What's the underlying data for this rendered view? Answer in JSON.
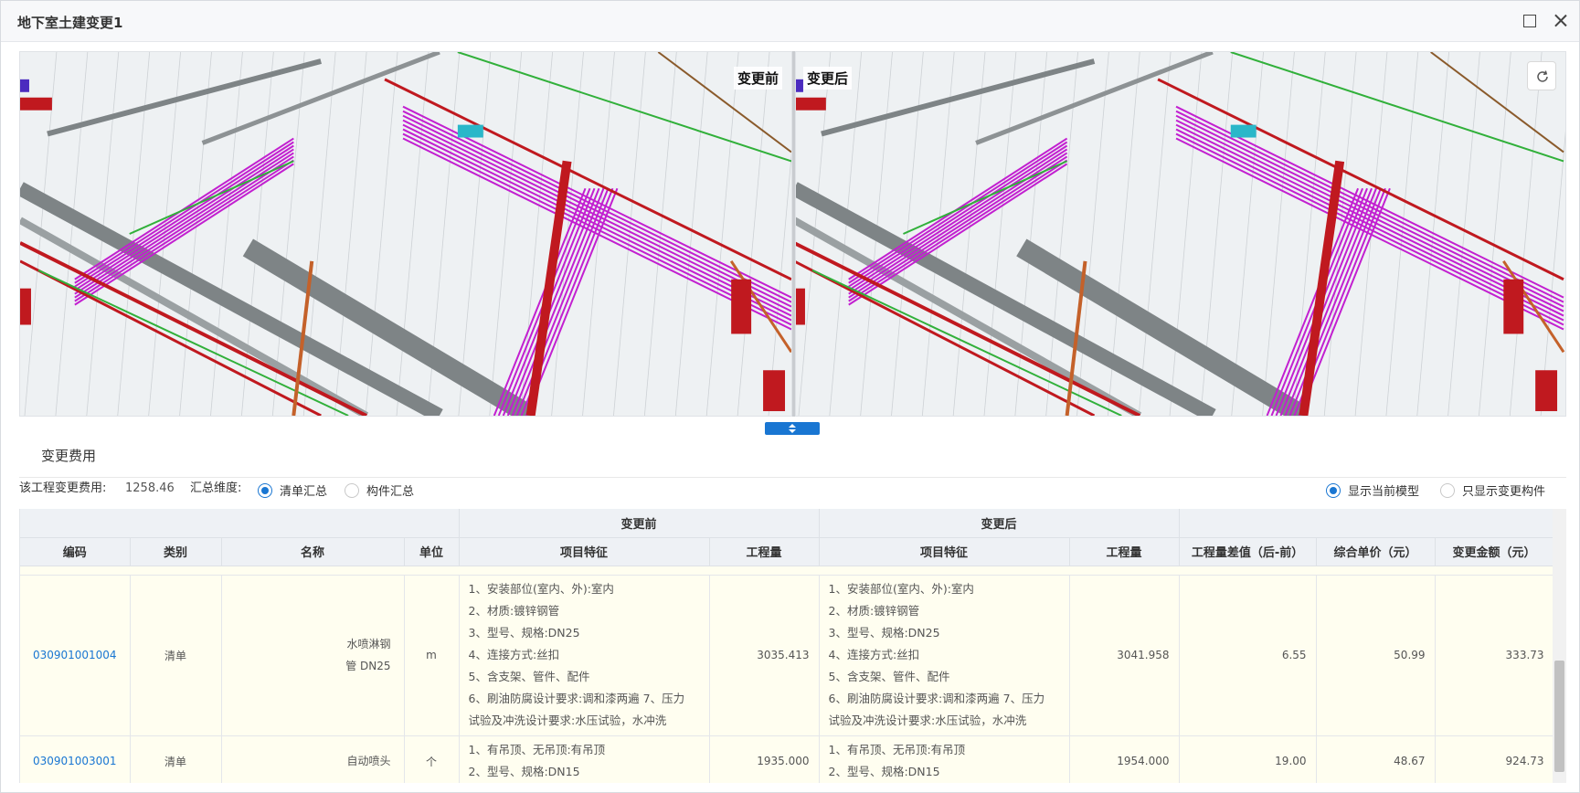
{
  "window": {
    "title": "地下室土建变更1"
  },
  "viewers": {
    "before_label": "变更前",
    "after_label": "变更后"
  },
  "section": {
    "title": "变更费用"
  },
  "filters": {
    "total_label": "该工程变更费用:",
    "total_value": "1258.46",
    "dimension_label": "汇总维度:",
    "option_list": "清单汇总",
    "option_component": "构件汇总",
    "option_list_selected": true,
    "show_current": "显示当前模型",
    "show_changed": "只显示变更构件",
    "show_current_selected": true
  },
  "table": {
    "group_before": "变更前",
    "group_after": "变更后",
    "headers": [
      "编码",
      "类别",
      "名称",
      "单位",
      "项目特征",
      "工程量",
      "项目特征",
      "工程量",
      "工程量差值（后-前）",
      "综合单价（元）",
      "变更金额（元）"
    ],
    "rows": [
      {
        "code": "030901001004",
        "category": "清单",
        "name_line1": "水喷淋钢",
        "name_line2": "管 DN25",
        "unit": "m",
        "before_features": [
          "1、安装部位(室内、外):室内",
          "2、材质:镀锌钢管",
          "3、型号、规格:DN25",
          "4、连接方式:丝扣",
          "5、含支架、管件、配件",
          "6、刷油防腐设计要求:调和漆两遍 7、压力",
          "试验及冲洗设计要求:水压试验，水冲洗"
        ],
        "before_qty": "3035.413",
        "after_features": [
          "1、安装部位(室内、外):室内",
          "2、材质:镀锌钢管",
          "3、型号、规格:DN25",
          "4、连接方式:丝扣",
          "5、含支架、管件、配件",
          "6、刷油防腐设计要求:调和漆两遍 7、压力",
          "试验及冲洗设计要求:水压试验，水冲洗"
        ],
        "after_qty": "3041.958",
        "diff": "6.55",
        "unit_price": "50.99",
        "amount": "333.73"
      },
      {
        "code": "030901003001",
        "category": "清单",
        "name_line1": "自动喷头",
        "unit": "个",
        "before_features": [
          "1、有吊顶、无吊顶:有吊顶",
          "2、型号、规格:DN15"
        ],
        "before_qty": "1935.000",
        "after_features": [
          "1、有吊顶、无吊顶:有吊顶",
          "2、型号、规格:DN15"
        ],
        "after_qty": "1954.000",
        "diff": "19.00",
        "unit_price": "48.67",
        "amount": "924.73"
      }
    ]
  },
  "colors": {
    "accent": "#1976d2",
    "row_highlight": "#fffef0",
    "pipe_magenta": "#c21fd0",
    "pipe_red": "#c0191f",
    "pipe_green": "#31b03a",
    "pipe_gray": "#7e8486",
    "pipe_orange": "#c4612a"
  },
  "icons": {
    "maximize": "maximize-icon",
    "close": "close-icon",
    "reset": "refresh-icon",
    "splitter": "sort-arrows-icon"
  }
}
